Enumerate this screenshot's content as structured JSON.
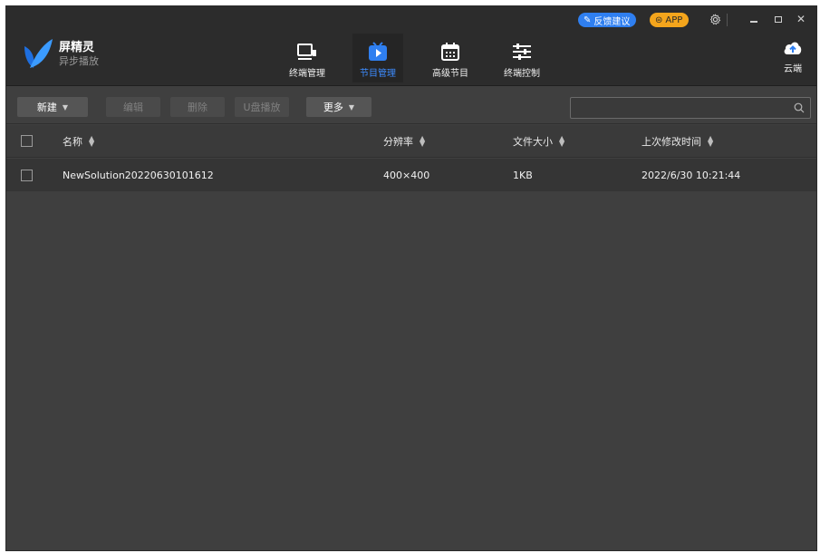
{
  "brand": {
    "name": "屏精灵",
    "subtitle": "异步播放"
  },
  "top_bar": {
    "feedback_label": "反馈建议",
    "app_label": "APP",
    "settings_icon": "gear-icon",
    "minimize_icon": "minimize-icon",
    "maximize_icon": "maximize-icon",
    "close_icon": "close-icon"
  },
  "nav": {
    "items": [
      {
        "label": "终端管理",
        "icon": "monitor-icon",
        "active": false
      },
      {
        "label": "节目管理",
        "icon": "tv-play-icon",
        "active": true
      },
      {
        "label": "高级节目",
        "icon": "calendar-icon",
        "active": false
      },
      {
        "label": "终端控制",
        "icon": "sliders-icon",
        "active": false
      }
    ],
    "cloud_label": "云端"
  },
  "toolbar": {
    "new_label": "新建",
    "edit_label": "编辑",
    "delete_label": "删除",
    "usb_play_label": "U盘播放",
    "more_label": "更多",
    "search_placeholder": ""
  },
  "table": {
    "columns": [
      "名称",
      "分辨率",
      "文件大小",
      "上次修改时间"
    ],
    "rows": [
      {
        "name": "NewSolution20220630101612",
        "resolution": "400×400",
        "size": "1KB",
        "modified": "2022/6/30 10:21:44"
      }
    ]
  },
  "colors": {
    "accent_blue": "#2f7ff0",
    "app_orange": "#f4a51c",
    "active_tab": "#3d8cff",
    "background": "#3f3f3f",
    "header": "#2c2c2c"
  }
}
